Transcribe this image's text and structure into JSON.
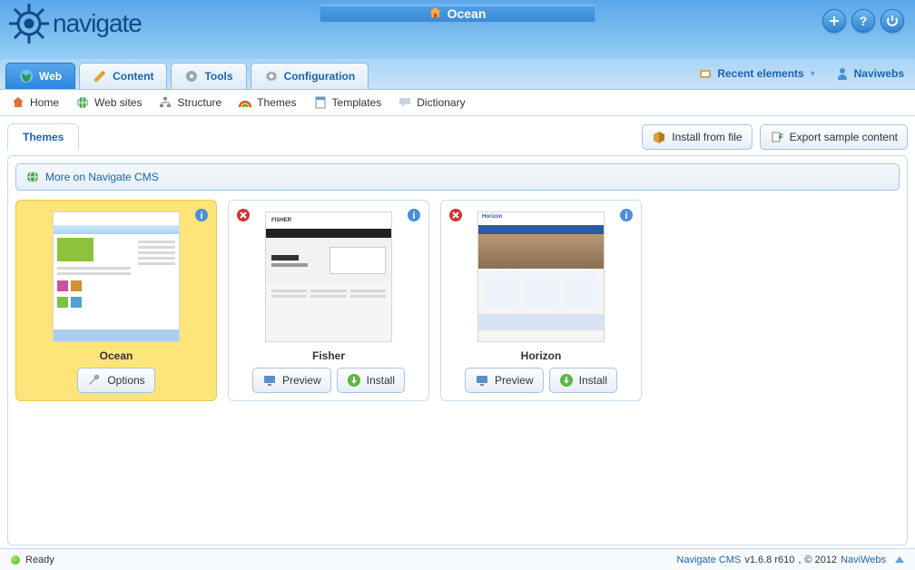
{
  "header": {
    "logo_text": "navigate",
    "site_name": "Ocean"
  },
  "main_tabs": [
    {
      "id": "web",
      "label": "Web",
      "active": true
    },
    {
      "id": "content",
      "label": "Content",
      "active": false
    },
    {
      "id": "tools",
      "label": "Tools",
      "active": false
    },
    {
      "id": "config",
      "label": "Configuration",
      "active": false
    }
  ],
  "right_nav": {
    "recent": "Recent elements",
    "user": "Naviwebs"
  },
  "sub_nav": [
    {
      "id": "home",
      "label": "Home"
    },
    {
      "id": "websites",
      "label": "Web sites"
    },
    {
      "id": "structure",
      "label": "Structure"
    },
    {
      "id": "themes",
      "label": "Themes"
    },
    {
      "id": "templates",
      "label": "Templates"
    },
    {
      "id": "dictionary",
      "label": "Dictionary"
    }
  ],
  "section": {
    "title": "Themes",
    "actions": {
      "install_file": "Install from file",
      "export_sample": "Export sample content"
    },
    "info_bar": "More on Navigate CMS"
  },
  "buttons": {
    "options": "Options",
    "preview": "Preview",
    "install": "Install"
  },
  "themes": [
    {
      "name": "Ocean",
      "active": true
    },
    {
      "name": "Fisher",
      "active": false
    },
    {
      "name": "Horizon",
      "active": false
    }
  ],
  "status": {
    "ready": "Ready",
    "product": "Navigate CMS",
    "version": "v1.6.8 r610",
    "sep": ",",
    "copyright": "© 2012",
    "company": "NaviWebs"
  }
}
